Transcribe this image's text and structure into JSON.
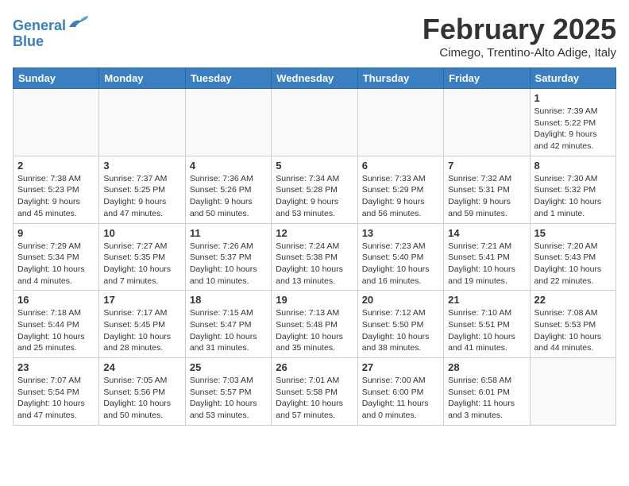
{
  "logo": {
    "line1": "General",
    "line2": "Blue"
  },
  "title": "February 2025",
  "location": "Cimego, Trentino-Alto Adige, Italy",
  "days_of_week": [
    "Sunday",
    "Monday",
    "Tuesday",
    "Wednesday",
    "Thursday",
    "Friday",
    "Saturday"
  ],
  "weeks": [
    [
      {
        "day": "",
        "info": ""
      },
      {
        "day": "",
        "info": ""
      },
      {
        "day": "",
        "info": ""
      },
      {
        "day": "",
        "info": ""
      },
      {
        "day": "",
        "info": ""
      },
      {
        "day": "",
        "info": ""
      },
      {
        "day": "1",
        "info": "Sunrise: 7:39 AM\nSunset: 5:22 PM\nDaylight: 9 hours and 42 minutes."
      }
    ],
    [
      {
        "day": "2",
        "info": "Sunrise: 7:38 AM\nSunset: 5:23 PM\nDaylight: 9 hours and 45 minutes."
      },
      {
        "day": "3",
        "info": "Sunrise: 7:37 AM\nSunset: 5:25 PM\nDaylight: 9 hours and 47 minutes."
      },
      {
        "day": "4",
        "info": "Sunrise: 7:36 AM\nSunset: 5:26 PM\nDaylight: 9 hours and 50 minutes."
      },
      {
        "day": "5",
        "info": "Sunrise: 7:34 AM\nSunset: 5:28 PM\nDaylight: 9 hours and 53 minutes."
      },
      {
        "day": "6",
        "info": "Sunrise: 7:33 AM\nSunset: 5:29 PM\nDaylight: 9 hours and 56 minutes."
      },
      {
        "day": "7",
        "info": "Sunrise: 7:32 AM\nSunset: 5:31 PM\nDaylight: 9 hours and 59 minutes."
      },
      {
        "day": "8",
        "info": "Sunrise: 7:30 AM\nSunset: 5:32 PM\nDaylight: 10 hours and 1 minute."
      }
    ],
    [
      {
        "day": "9",
        "info": "Sunrise: 7:29 AM\nSunset: 5:34 PM\nDaylight: 10 hours and 4 minutes."
      },
      {
        "day": "10",
        "info": "Sunrise: 7:27 AM\nSunset: 5:35 PM\nDaylight: 10 hours and 7 minutes."
      },
      {
        "day": "11",
        "info": "Sunrise: 7:26 AM\nSunset: 5:37 PM\nDaylight: 10 hours and 10 minutes."
      },
      {
        "day": "12",
        "info": "Sunrise: 7:24 AM\nSunset: 5:38 PM\nDaylight: 10 hours and 13 minutes."
      },
      {
        "day": "13",
        "info": "Sunrise: 7:23 AM\nSunset: 5:40 PM\nDaylight: 10 hours and 16 minutes."
      },
      {
        "day": "14",
        "info": "Sunrise: 7:21 AM\nSunset: 5:41 PM\nDaylight: 10 hours and 19 minutes."
      },
      {
        "day": "15",
        "info": "Sunrise: 7:20 AM\nSunset: 5:43 PM\nDaylight: 10 hours and 22 minutes."
      }
    ],
    [
      {
        "day": "16",
        "info": "Sunrise: 7:18 AM\nSunset: 5:44 PM\nDaylight: 10 hours and 25 minutes."
      },
      {
        "day": "17",
        "info": "Sunrise: 7:17 AM\nSunset: 5:45 PM\nDaylight: 10 hours and 28 minutes."
      },
      {
        "day": "18",
        "info": "Sunrise: 7:15 AM\nSunset: 5:47 PM\nDaylight: 10 hours and 31 minutes."
      },
      {
        "day": "19",
        "info": "Sunrise: 7:13 AM\nSunset: 5:48 PM\nDaylight: 10 hours and 35 minutes."
      },
      {
        "day": "20",
        "info": "Sunrise: 7:12 AM\nSunset: 5:50 PM\nDaylight: 10 hours and 38 minutes."
      },
      {
        "day": "21",
        "info": "Sunrise: 7:10 AM\nSunset: 5:51 PM\nDaylight: 10 hours and 41 minutes."
      },
      {
        "day": "22",
        "info": "Sunrise: 7:08 AM\nSunset: 5:53 PM\nDaylight: 10 hours and 44 minutes."
      }
    ],
    [
      {
        "day": "23",
        "info": "Sunrise: 7:07 AM\nSunset: 5:54 PM\nDaylight: 10 hours and 47 minutes."
      },
      {
        "day": "24",
        "info": "Sunrise: 7:05 AM\nSunset: 5:56 PM\nDaylight: 10 hours and 50 minutes."
      },
      {
        "day": "25",
        "info": "Sunrise: 7:03 AM\nSunset: 5:57 PM\nDaylight: 10 hours and 53 minutes."
      },
      {
        "day": "26",
        "info": "Sunrise: 7:01 AM\nSunset: 5:58 PM\nDaylight: 10 hours and 57 minutes."
      },
      {
        "day": "27",
        "info": "Sunrise: 7:00 AM\nSunset: 6:00 PM\nDaylight: 11 hours and 0 minutes."
      },
      {
        "day": "28",
        "info": "Sunrise: 6:58 AM\nSunset: 6:01 PM\nDaylight: 11 hours and 3 minutes."
      },
      {
        "day": "",
        "info": ""
      }
    ]
  ]
}
